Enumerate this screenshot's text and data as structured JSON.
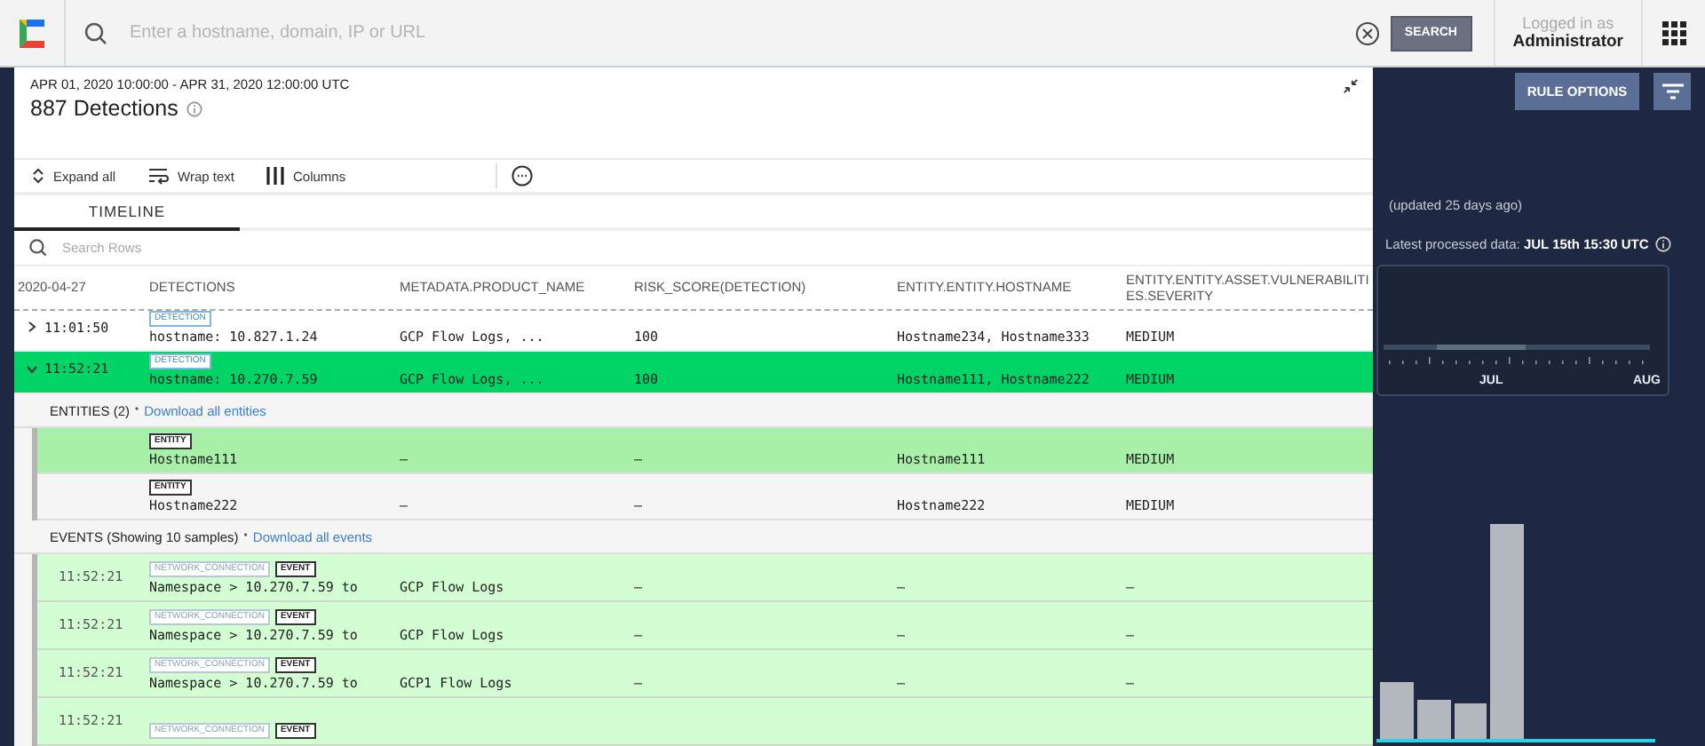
{
  "topbar": {
    "search": {
      "placeholder": "Enter a hostname, domain, IP or URL"
    },
    "search_button": "SEARCH",
    "user": {
      "caption": "Logged in as",
      "name": "Administrator"
    }
  },
  "panel": {
    "range": "APR 01, 2020 10:00:00 - APR 31, 2020 12:00:00 UTC",
    "title": "887 Detections",
    "toolbar": [
      {
        "kind": "expand",
        "label": "Expand all"
      },
      {
        "kind": "wrap",
        "label": "Wrap text"
      },
      {
        "kind": "columns",
        "label": "Columns"
      }
    ],
    "tabs": [
      {
        "label": "TIMELINE",
        "selected": true
      }
    ],
    "row_search": {
      "placeholder": "Search Rows"
    },
    "columns": [
      "2020-04-27",
      "DETECTIONS",
      "METADATA.PRODUCT_NAME",
      "RISK_SCORE(DETECTION)",
      "ENTITY.ENTITY.HOSTNAME",
      "ENTITY.ENTITY.ASSET.VULNERABILITIES.SEVERITY"
    ],
    "detections": [
      {
        "expanded": false,
        "selected": false,
        "time": "11:01:50",
        "tag": "DETECTION",
        "text": "hostname: 10.827.1.24",
        "product": "GCP Flow Logs, ...",
        "risk": "100",
        "hostnames": "Hostname234, Hostname333",
        "severity": "MEDIUM"
      },
      {
        "expanded": true,
        "selected": true,
        "time": "11:52:21",
        "tag": "DETECTION",
        "text": "hostname: 10.270.7.59",
        "product": "GCP Flow Logs, ...",
        "risk": "100",
        "hostnames": "Hostname111, Hostname222",
        "severity": "MEDIUM"
      }
    ],
    "entities": {
      "label": "ENTITIES",
      "count": "(2)",
      "separator": "•",
      "link": "Download all entities",
      "rows": [
        {
          "selected": true,
          "tag": "ENTITY",
          "name": "Hostname111",
          "product": "–",
          "risk": "–",
          "hostname": "Hostname111",
          "severity": "MEDIUM"
        },
        {
          "selected": false,
          "tag": "ENTITY",
          "name": "Hostname222",
          "product": "–",
          "risk": "–",
          "hostname": "Hostname222",
          "severity": "MEDIUM"
        }
      ]
    },
    "events": {
      "label": "EVENTS",
      "note": "(Showing 10 samples)",
      "separator": "•",
      "link": "Download all events",
      "rows": [
        {
          "time": "11:52:21",
          "type": "NETWORK_CONNECTION",
          "tag": "EVENT",
          "text": "Namespace > 10.270.7.59 to",
          "product": "GCP Flow Logs",
          "risk": "–",
          "hostname": "–",
          "severity": "–"
        },
        {
          "time": "11:52:21",
          "type": "NETWORK_CONNECTION",
          "tag": "EVENT",
          "text": "Namespace > 10.270.7.59 to",
          "product": "GCP Flow Logs",
          "risk": "–",
          "hostname": "–",
          "severity": "–"
        },
        {
          "time": "11:52:21",
          "type": "NETWORK_CONNECTION",
          "tag": "EVENT",
          "text": "Namespace > 10.270.7.59 to",
          "product": "GCP1 Flow Logs",
          "risk": "–",
          "hostname": "–",
          "severity": "–"
        },
        {
          "time": "11:52:21",
          "type": "NETWORK_CONNECTION",
          "tag": "EVENT"
        }
      ]
    }
  },
  "side": {
    "rule_options": "RULE OPTIONS",
    "updated": "(updated 25 days ago)",
    "latest": "Latest processed data: **JUL 15th 15:30 UTC**",
    "timeline_labels": [
      "JUL",
      "AUG"
    ]
  }
}
